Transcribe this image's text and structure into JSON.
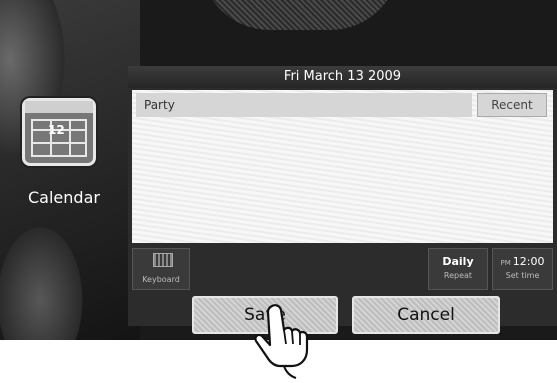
{
  "home": {
    "app_icon": "calendar-icon",
    "app_icon_number": "12",
    "app_label": "Calendar"
  },
  "dialog": {
    "date": "Fri March 13 2009",
    "event_value": "Party",
    "recent_label": "Recent",
    "keyboard_icon": "keyboard-icon",
    "keyboard_label": "Keyboard",
    "repeat_value": "Daily",
    "repeat_label": "Repeat",
    "time_ampm": "PM",
    "time_value": "12:00",
    "time_label": "Set time",
    "save_label": "Save",
    "cancel_label": "Cancel"
  },
  "pointer_icon": "hand-pointer-icon"
}
